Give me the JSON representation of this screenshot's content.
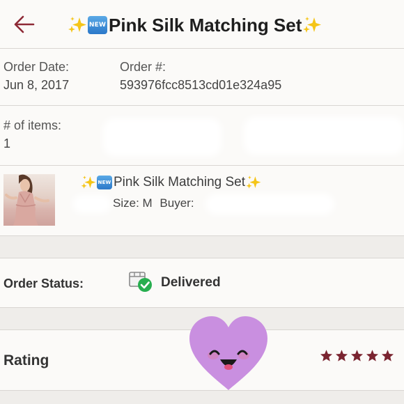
{
  "header": {
    "badge_text": "NEW",
    "title": "Pink Silk Matching Set",
    "back_icon": "back-arrow-icon",
    "accent_color": "#8e2a36"
  },
  "order": {
    "date_label": "Order Date:",
    "date_value": "Jun 8, 2017",
    "number_label": "Order #:",
    "number_value": "593976fcc8513cd01e324a95"
  },
  "items": {
    "count_label": "# of items:",
    "count_value": "1"
  },
  "product": {
    "title": "Pink Silk Matching Set",
    "badge_text": "NEW",
    "size_text": "Size: M",
    "buyer_label": "Buyer:"
  },
  "status": {
    "label": "Order Status:",
    "value": "Delivered",
    "icon": "delivered-box-icon",
    "check_color": "#27ae4f"
  },
  "rating": {
    "label": "Rating",
    "stars": 5,
    "max_stars": 5,
    "star_color": "#7a2430"
  },
  "sticker": {
    "icon": "smiling-heart-icon",
    "color": "#c98fe0"
  }
}
